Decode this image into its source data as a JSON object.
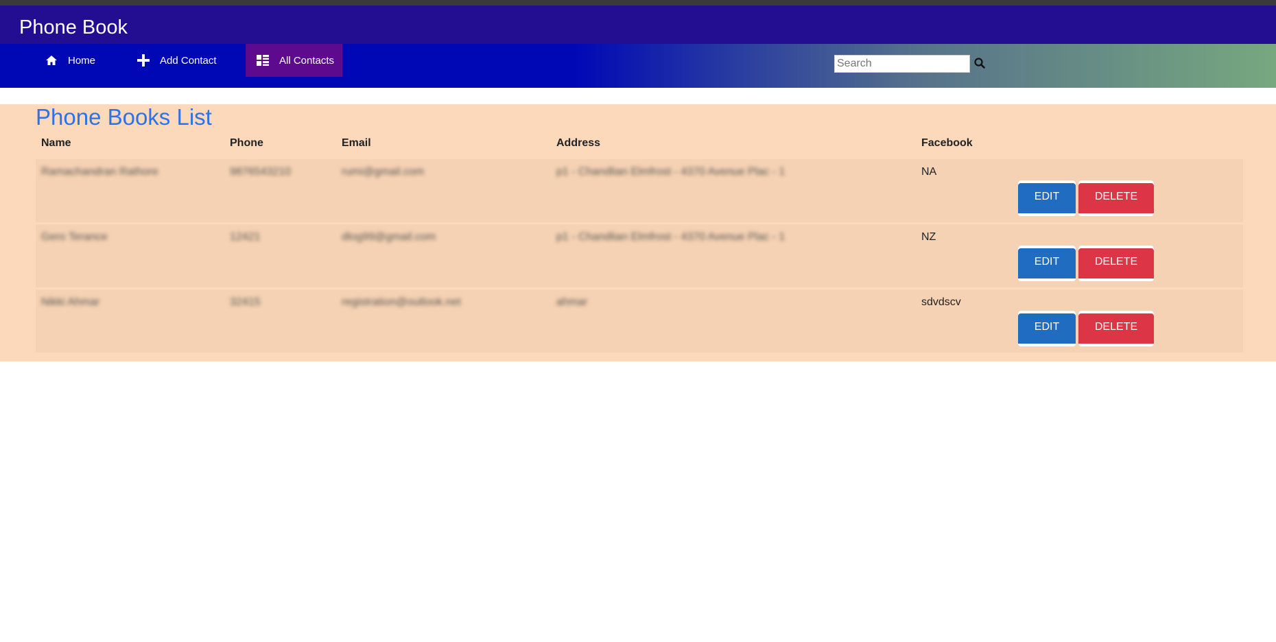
{
  "app": {
    "title": "Phone Book"
  },
  "nav": {
    "items": [
      {
        "label": "Home",
        "icon": "home-icon"
      },
      {
        "label": "Add Contact",
        "icon": "plus-icon"
      },
      {
        "label": "All Contacts",
        "icon": "list-icon",
        "active": true
      }
    ]
  },
  "search": {
    "placeholder": "Search",
    "value": ""
  },
  "page": {
    "title": "Phone Books List"
  },
  "table": {
    "columns": [
      "Name",
      "Phone",
      "Email",
      "Address",
      "Facebook"
    ],
    "rows": [
      {
        "name": "Ramachandran Rathore",
        "phone": "9876543210",
        "email": "rumi@gmail.com",
        "address": "p1 - Chandlian Elmfrost - 4370 Avenue Plac - 1",
        "facebook": "NA",
        "edit_label": "EDIT",
        "delete_label": "DELETE"
      },
      {
        "name": "Gero Terance",
        "phone": "12421",
        "email": "dlog99@gmail.com",
        "address": "p1 - Chandlian Elmfrost - 4370 Avenue Plac - 1",
        "facebook": "NZ",
        "edit_label": "EDIT",
        "delete_label": "DELETE"
      },
      {
        "name": "Nikki Ahmar",
        "phone": "32415",
        "email": "registration@outlook.net",
        "address": "ahmar",
        "facebook": "sdvdscv",
        "edit_label": "EDIT",
        "delete_label": "DELETE"
      }
    ]
  },
  "colors": {
    "title_bar": "#230e91",
    "nav_bar": "#0008b6",
    "nav_active": "#5e0a8f",
    "panel_bg": "#fcd9ba",
    "row_bg": "#f5d2b3",
    "page_title": "#2d72e8",
    "edit_button": "#1f6cc1",
    "delete_button": "#dc3545"
  }
}
